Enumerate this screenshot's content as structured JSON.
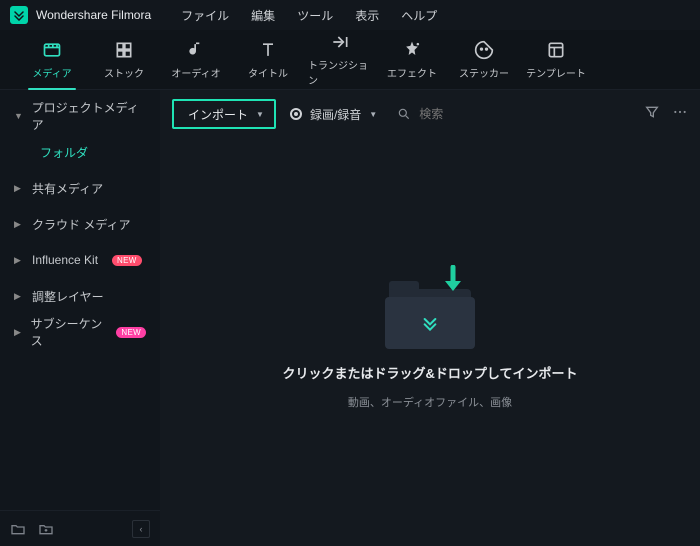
{
  "app": {
    "name": "Wondershare Filmora"
  },
  "menubar": {
    "items": [
      "ファイル",
      "編集",
      "ツール",
      "表示",
      "ヘルプ"
    ]
  },
  "tabs": {
    "items": [
      {
        "key": "media",
        "label": "メディア",
        "active": true
      },
      {
        "key": "stock",
        "label": "ストック"
      },
      {
        "key": "audio",
        "label": "オーディオ"
      },
      {
        "key": "title",
        "label": "タイトル"
      },
      {
        "key": "transition",
        "label": "トランジション"
      },
      {
        "key": "effect",
        "label": "エフェクト"
      },
      {
        "key": "sticker",
        "label": "ステッカー"
      },
      {
        "key": "template",
        "label": "テンプレート"
      }
    ]
  },
  "sidebar": {
    "items": [
      {
        "label": "プロジェクトメディア",
        "expanded": true
      },
      {
        "label": "フォルダ",
        "sub": true,
        "active": true
      },
      {
        "label": "共有メディア"
      },
      {
        "label": "クラウド メディア"
      },
      {
        "label": "Influence Kit",
        "badge": "NEW",
        "badgeColor": "red"
      },
      {
        "label": "調整レイヤー"
      },
      {
        "label": "サブシーケンス",
        "badge": "NEW",
        "badgeColor": "pink"
      }
    ]
  },
  "toolbar": {
    "import_label": "インポート",
    "record_label": "録画/録音",
    "search_placeholder": "検索"
  },
  "dropzone": {
    "title": "クリックまたはドラッグ&ドロップしてインポート",
    "subtitle": "動画、オーディオファイル、画像"
  },
  "colors": {
    "accent": "#30e0c0"
  }
}
